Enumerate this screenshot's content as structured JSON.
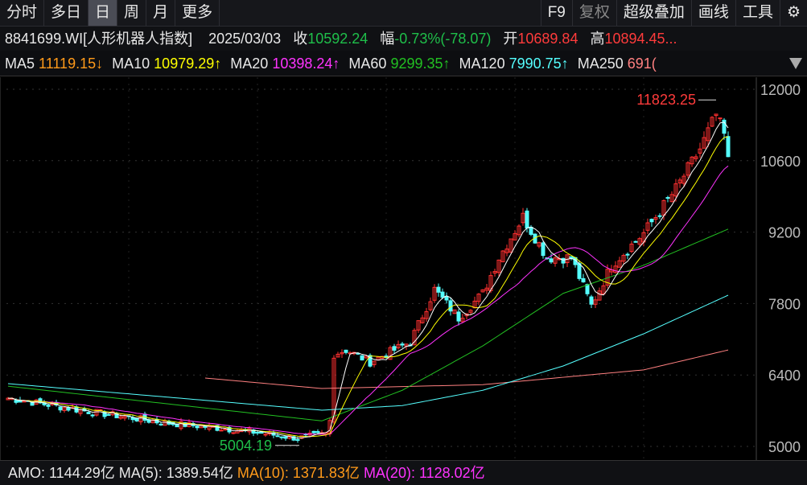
{
  "toolbar": {
    "left": [
      "分时",
      "多日",
      "日",
      "周",
      "月",
      "更多"
    ],
    "active": "日",
    "right": [
      "F9",
      "复权",
      "超级叠加",
      "画线",
      "工具"
    ]
  },
  "info": {
    "code": "8841699.WI[人形机器人指数]",
    "date": "2025/03/03",
    "close_label": "收",
    "close": "10592.24",
    "change_label": "幅",
    "change": "-0.73%(-78.07)",
    "open_label": "开",
    "open": "10689.84",
    "high_label": "高",
    "high": "10894.45..."
  },
  "ma_legend": [
    {
      "label": "MA5",
      "value": "11119.15↓",
      "color": "#ff9a1a"
    },
    {
      "label": "MA10",
      "value": "10979.29↑",
      "color": "#ffff00"
    },
    {
      "label": "MA20",
      "value": "10398.24↑",
      "color": "#ff33ff"
    },
    {
      "label": "MA60",
      "value": "9299.35↑",
      "color": "#22c022"
    },
    {
      "label": "MA120",
      "value": "7990.75↑",
      "color": "#55ffff"
    },
    {
      "label": "MA250",
      "value": "691(",
      "color": "#ff8080"
    }
  ],
  "amo": {
    "amo": "AMO: 1144.29亿",
    "ma5": "MA(5): 1389.54亿",
    "ma10": "MA(10): 1371.83亿",
    "ma20": "MA(20): 1128.02亿",
    "colors": {
      "ma10": "#ff9a1a",
      "ma20": "#ff33ff"
    }
  },
  "chart_data": {
    "type": "candlestick",
    "ylim": [
      4850,
      12250
    ],
    "y_ticks": [
      "12000",
      "10600",
      "9200",
      "7800",
      "6400",
      "5000"
    ],
    "max_label": "11823.25",
    "min_label": "5004.19",
    "close_waypoints": [
      [
        0,
        5946
      ],
      [
        18,
        5710
      ],
      [
        38,
        5473
      ],
      [
        58,
        5315
      ],
      [
        72,
        5160
      ],
      [
        79,
        5250
      ],
      [
        80,
        5500
      ],
      [
        81,
        6810
      ],
      [
        84,
        6890
      ],
      [
        90,
        6655
      ],
      [
        100,
        7050
      ],
      [
        106,
        8075
      ],
      [
        112,
        7520
      ],
      [
        118,
        8000
      ],
      [
        122,
        8700
      ],
      [
        128,
        9500
      ],
      [
        134,
        8700
      ],
      [
        140,
        8700
      ],
      [
        145,
        7760
      ],
      [
        150,
        8550
      ],
      [
        158,
        9180
      ],
      [
        166,
        10045
      ],
      [
        172,
        10830
      ],
      [
        176,
        11500
      ],
      [
        178,
        11100
      ],
      [
        179,
        10592
      ]
    ],
    "ma60_waypoints": [
      [
        0,
        6180
      ],
      [
        78,
        5500
      ],
      [
        98,
        6100
      ],
      [
        118,
        6970
      ],
      [
        138,
        8000
      ],
      [
        158,
        8550
      ],
      [
        179,
        9260
      ]
    ],
    "ma120_waypoints": [
      [
        0,
        6230
      ],
      [
        78,
        5710
      ],
      [
        98,
        5800
      ],
      [
        118,
        6100
      ],
      [
        138,
        6577
      ],
      [
        158,
        7207
      ],
      [
        179,
        7964
      ]
    ],
    "ma250_waypoints": [
      [
        49,
        6340
      ],
      [
        78,
        6135
      ],
      [
        118,
        6210
      ],
      [
        158,
        6500
      ],
      [
        179,
        6890
      ]
    ],
    "colors": {
      "up": "#ff3030",
      "down": "#55ffff",
      "ma5": "#ffffff",
      "ma10": "#ffff00",
      "ma20": "#ff33ff",
      "ma60": "#22c022",
      "ma120": "#55ffff",
      "ma250": "#ff8080"
    }
  }
}
